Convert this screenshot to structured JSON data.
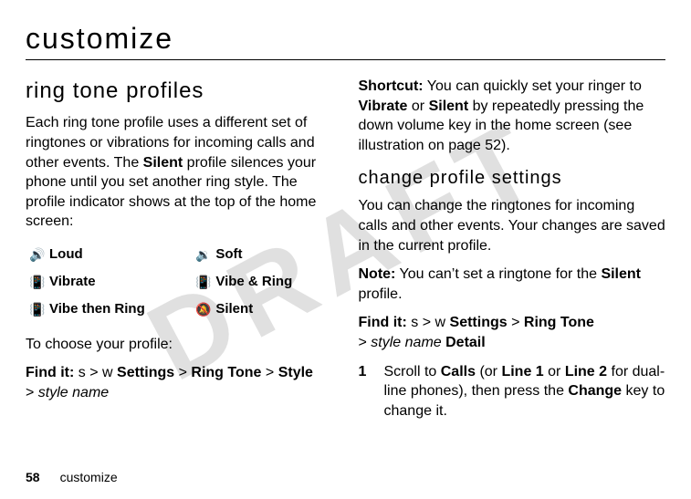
{
  "watermark": "DRAFT",
  "page_title": "customize",
  "left": {
    "section_heading": "ring tone profiles",
    "intro_part1": "Each ring tone profile uses a different set of ringtones or vibrations for incoming calls and other events. The ",
    "intro_silent": "Silent",
    "intro_part2": " profile silences your phone until you set another ring style. The profile indicator shows at the top of the home screen:",
    "profiles": [
      {
        "icon": "🔊",
        "label": "Loud"
      },
      {
        "icon": "🔉",
        "label": "Soft"
      },
      {
        "icon": "📳",
        "label": "Vibrate"
      },
      {
        "icon": "📳",
        "label": "Vibe & Ring"
      },
      {
        "icon": "📳",
        "label": "Vibe then Ring"
      },
      {
        "icon": "🔕",
        "label": "Silent"
      }
    ],
    "choose_text": "To choose your profile:",
    "findit_label": "Find it:",
    "findit_key": "s",
    "findit_sep": ">",
    "findit_settings_icon": "w",
    "findit_settings": "Settings",
    "findit_ringtone": "Ring Tone",
    "findit_style": "Style",
    "findit_stylename": "style name"
  },
  "right": {
    "shortcut_label": "Shortcut:",
    "shortcut_part1": " You can quickly set your ringer to ",
    "shortcut_vibrate": "Vibrate",
    "shortcut_or": " or ",
    "shortcut_silent": "Silent",
    "shortcut_part2": " by repeatedly pressing the down volume key in the home screen (see illustration on page 52).",
    "subsection": "change profile settings",
    "change_text": "You can change the ringtones for incoming calls and other events. Your changes are saved in the current profile.",
    "note_label": "Note:",
    "note_part1": " You can’t set a ringtone for the ",
    "note_silent": "Silent",
    "note_part2": " profile.",
    "findit_label": "Find it:",
    "findit_key": "s",
    "findit_sep": ">",
    "findit_settings_icon": "w",
    "findit_settings": "Settings",
    "findit_ringtone": "Ring Tone",
    "findit_stylename": "style name",
    "findit_detail": "Detail",
    "step1_num": "1",
    "step1_a": "Scroll to ",
    "step1_calls": "Calls",
    "step1_b": " (or ",
    "step1_line1": "Line 1",
    "step1_c": " or ",
    "step1_line2": "Line 2",
    "step1_d": " for dual-line phones), then press the ",
    "step1_change": "Change",
    "step1_e": " key to change it."
  },
  "footer": {
    "page_number": "58",
    "section": "customize"
  }
}
